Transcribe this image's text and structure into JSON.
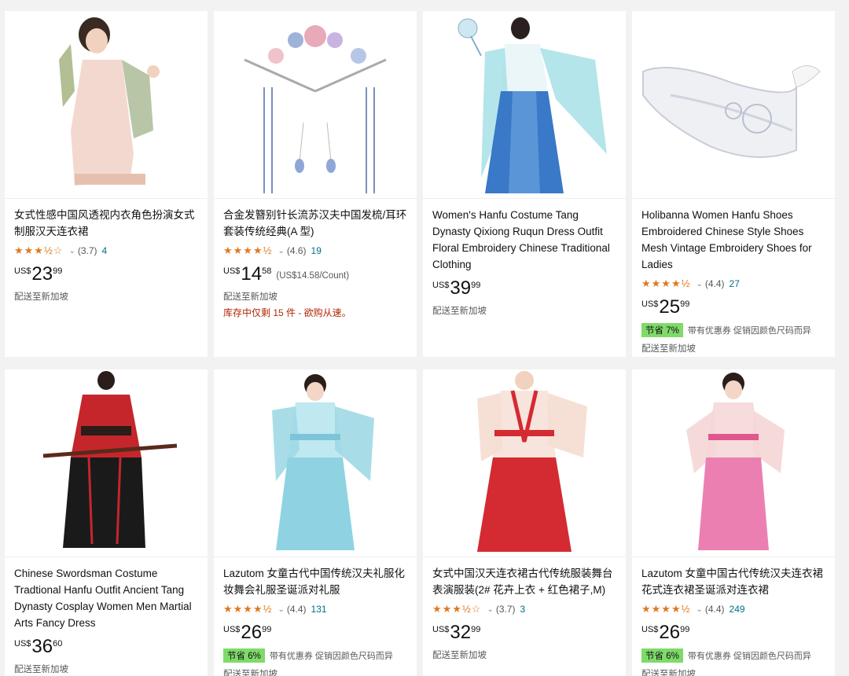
{
  "products": [
    {
      "title": "女式性感中国风透视内衣角色扮演女式制服汉天连衣裙",
      "stars": "★★★½☆",
      "rating": "(3.7)",
      "reviews": "4",
      "currency": "US$",
      "price_whole": "23",
      "price_frac": "99",
      "shipping": "配送至新加坡"
    },
    {
      "title": "合金发簪别针长流苏汉夫中国发梳/耳环套装传统经典(A 型)",
      "stars": "★★★★½",
      "rating": "(4.6)",
      "reviews": "19",
      "currency": "US$",
      "price_whole": "14",
      "price_frac": "58",
      "unit_price": "(US$14.58/Count)",
      "shipping": "配送至新加坡",
      "stock": "库存中仅剩 15 件 - 欲购从速。"
    },
    {
      "title": "Women's Hanfu Costume Tang Dynasty Qixiong Ruqun Dress Outfit Floral Embroidery Chinese Traditional Clothing",
      "currency": "US$",
      "price_whole": "39",
      "price_frac": "99",
      "shipping": "配送至新加坡"
    },
    {
      "title": "Holibanna Women Hanfu Shoes Embroidered Chinese Style Shoes Mesh Vintage Embroidery Shoes for Ladies",
      "stars": "★★★★½",
      "rating": "(4.4)",
      "reviews": "27",
      "currency": "US$",
      "price_whole": "25",
      "price_frac": "99",
      "save_badge": "节省 7%",
      "save_note": "带有优惠券 促销因颜色尺码而异",
      "shipping": "配送至新加坡"
    },
    {
      "title": "Chinese Swordsman Costume Tradtional Hanfu Outfit Ancient Tang Dynasty Cosplay Women Men Martial Arts Fancy Dress",
      "currency": "US$",
      "price_whole": "36",
      "price_frac": "60",
      "shipping": "配送至新加坡"
    },
    {
      "title": "Lazutom 女童古代中国传统汉夫礼服化妆舞会礼服圣诞派对礼服",
      "stars": "★★★★½",
      "rating": "(4.4)",
      "reviews": "131",
      "currency": "US$",
      "price_whole": "26",
      "price_frac": "99",
      "save_badge": "节省 6%",
      "save_note": "带有优惠券 促销因颜色尺码而异",
      "shipping": "配送至新加坡"
    },
    {
      "title": "女式中国汉天连衣裙古代传统服装舞台表演服装(2# 花卉上衣 + 红色裙子,M)",
      "stars": "★★★½☆",
      "rating": "(3.7)",
      "reviews": "3",
      "currency": "US$",
      "price_whole": "32",
      "price_frac": "99",
      "shipping": "配送至新加坡"
    },
    {
      "title": "Lazutom 女童中国古代传统汉夫连衣裙花式连衣裙圣诞派对连衣裙",
      "stars": "★★★★½",
      "rating": "(4.4)",
      "reviews": "249",
      "currency": "US$",
      "price_whole": "26",
      "price_frac": "99",
      "save_badge": "节省 6%",
      "save_note": "带有优惠券 促销因颜色尺码而异",
      "shipping": "配送至新加坡"
    }
  ],
  "colors": {
    "star": "#de7921",
    "link": "#007185",
    "save_badge": "#7fda69",
    "stock_red": "#b12704"
  }
}
